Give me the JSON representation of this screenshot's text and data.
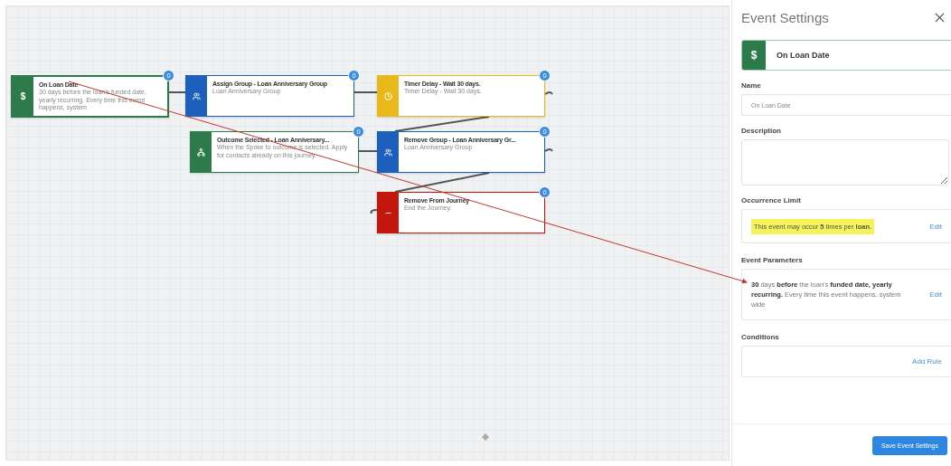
{
  "canvas": {
    "nodes": [
      {
        "kind": "event",
        "symbol": "$",
        "title": "On Loan Date",
        "description": "30 days before the loan's funded date, yearly recurring. Every time this event happens, system",
        "badge": "0",
        "selected": true
      },
      {
        "kind": "assign-group",
        "title": "Assign Group - Loan Anniversary Group",
        "description": "Loan Anniversary Group",
        "badge": "0",
        "selected": false
      },
      {
        "kind": "timer",
        "title": "Timer Delay - Wait 30 days.",
        "description": "Timer Delay - Wait 30 days.",
        "badge": "0",
        "selected": false
      },
      {
        "kind": "outcome",
        "title": "Outcome Selected - Loan Anniversary...",
        "description": "When the Spoke to outcome is selected. Apply for contacts already on this journey.",
        "badge": "0",
        "selected": false
      },
      {
        "kind": "remove-group",
        "title": "Remove Group - Loan Anniversary Gr...",
        "description": "Loan Anniversary Group",
        "badge": "0",
        "selected": false
      },
      {
        "kind": "exit",
        "title": "Remove From Journey",
        "description": "End the Journey.",
        "badge": "0",
        "selected": false
      }
    ]
  },
  "panel": {
    "title": "Event Settings",
    "event": {
      "symbol": "$",
      "name": "On Loan Date"
    },
    "name_field": {
      "label": "Name",
      "value": "On Loan Date"
    },
    "description_field": {
      "label": "Description"
    },
    "occurrence_limit": {
      "label": "Occurrence Limit",
      "text": "This event may occur **5** times per **loan**.",
      "action": "Edit"
    },
    "event_parameters": {
      "label": "Event Parameters",
      "text": "**30** days **before** the loan's **funded date, yearly recurring.** Every time this event happens, system wide",
      "action": "Edit"
    },
    "conditions": {
      "label": "Conditions",
      "action": "Add Rule"
    },
    "save_button": "Save Event Settings"
  }
}
